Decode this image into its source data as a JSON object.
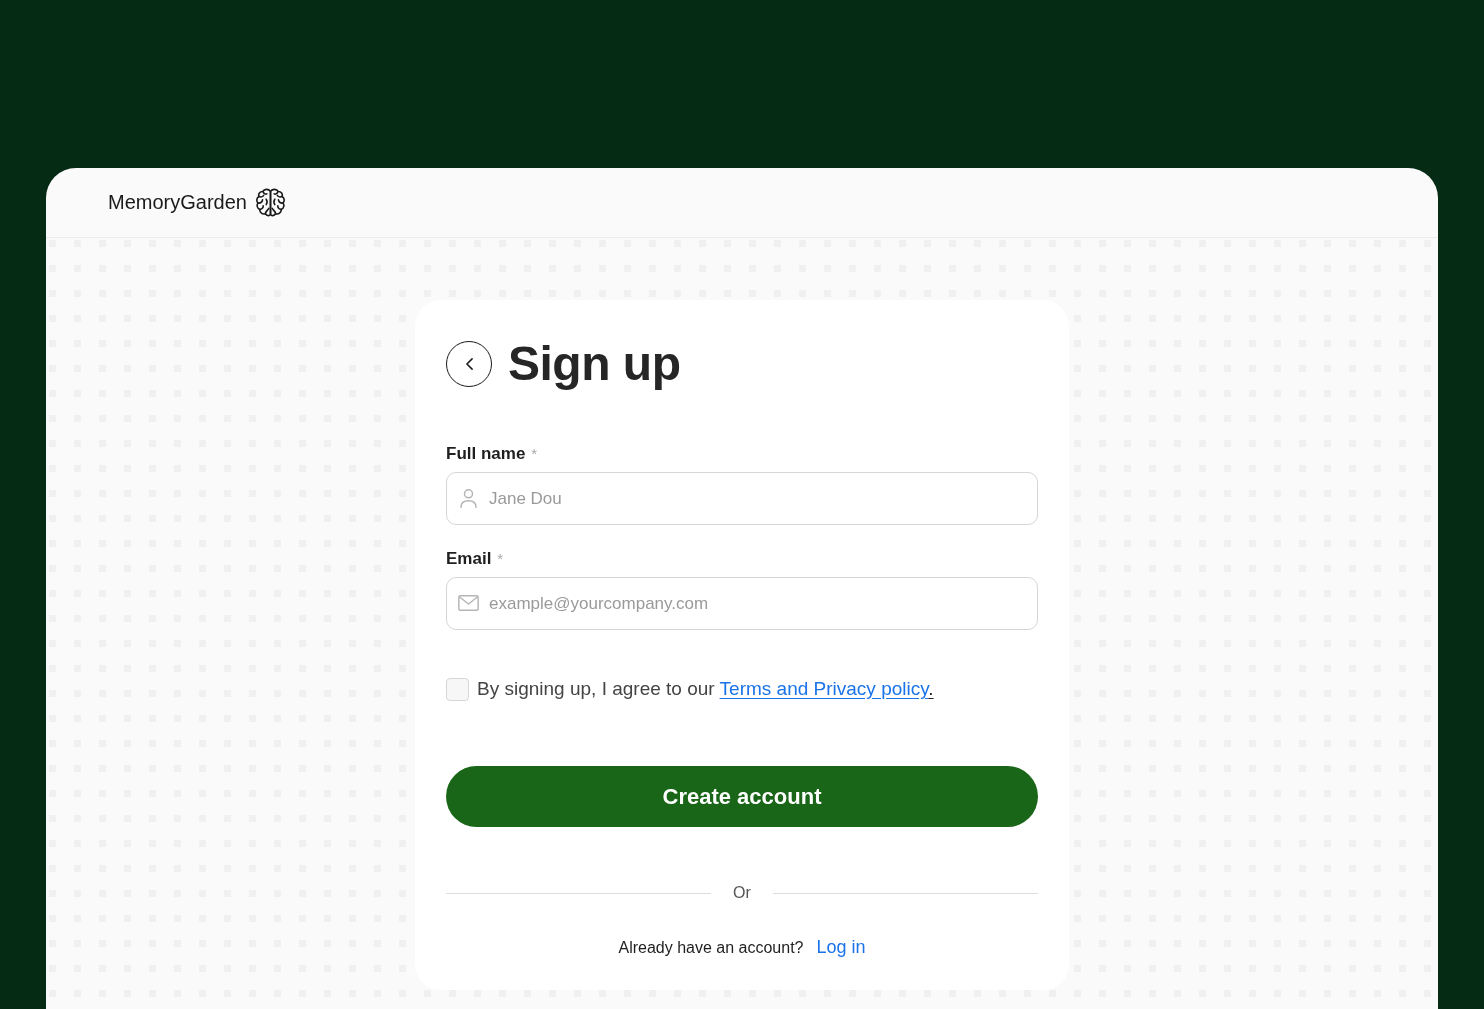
{
  "header": {
    "brand": "MemoryGarden"
  },
  "form": {
    "title": "Sign up",
    "fields": [
      {
        "kind": "name",
        "label": "Full name",
        "required_mark": "*",
        "placeholder": "Jane Dou"
      },
      {
        "kind": "email",
        "label": "Email",
        "required_mark": "*",
        "placeholder": "example@yourcompany.com"
      }
    ],
    "agreement": {
      "checked": false,
      "text": "By signing up, I agree to our ",
      "link": "Terms and Privacy policy",
      "suffix": "."
    },
    "submit": "Create account",
    "divider": "Or",
    "login_prompt": {
      "text": "Already have an account?",
      "link": "Log in"
    }
  }
}
